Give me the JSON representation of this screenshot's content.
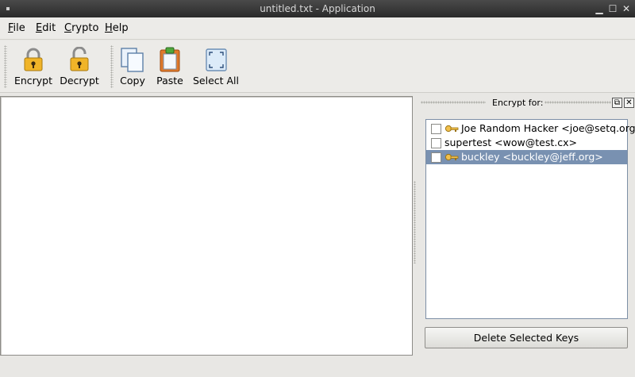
{
  "window": {
    "title": "untitled.txt - Application"
  },
  "menu": [
    {
      "label": "File",
      "mnemonic": "F",
      "rest": "ile"
    },
    {
      "label": "Edit",
      "mnemonic": "E",
      "rest": "dit"
    },
    {
      "label": "Crypto",
      "mnemonic": "C",
      "rest": "rypto"
    },
    {
      "label": "Help",
      "mnemonic": "H",
      "rest": "elp"
    }
  ],
  "toolbar": {
    "encrypt": "Encrypt",
    "decrypt": "Decrypt",
    "copy": "Copy",
    "paste": "Paste",
    "select_all": "Select All"
  },
  "editor": {
    "text": ""
  },
  "dock": {
    "title": "Encrypt for:",
    "keys": [
      {
        "label": "Joe Random Hacker <joe@setq.org>",
        "checked": false,
        "has_key_icon": true,
        "selected": false
      },
      {
        "label": "supertest <wow@test.cx>",
        "checked": false,
        "has_key_icon": false,
        "selected": false
      },
      {
        "label": "buckley <buckley@jeff.org>",
        "checked": false,
        "has_key_icon": true,
        "selected": true
      }
    ],
    "delete_button": "Delete Selected Keys"
  },
  "colors": {
    "selection": "#7991b1",
    "lock_gold": "#f0b428",
    "titlebar": "#333333"
  }
}
